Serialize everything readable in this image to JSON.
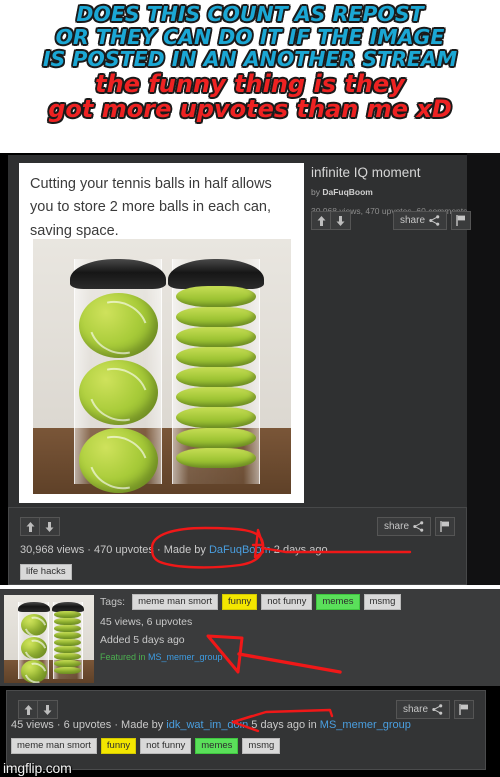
{
  "meme": {
    "caption_top_lines": [
      "DOES THIS COUNT AS REPOST",
      "OR THEY CAN DO IT IF THE IMAGE",
      "IS POSTED IN AN ANOTHER STREAM"
    ],
    "caption_bottom_lines": [
      "the funny thing is they",
      "got more upvotes than me xD"
    ],
    "caption_top_color": "#1ba7d4",
    "caption_bottom_color": "#ee2222",
    "watermark": "imgflip.com"
  },
  "post_top": {
    "image_caption": "Cutting your tennis balls in half allows you to store 2 more balls in each can, saving space.",
    "title": "infinite IQ moment",
    "by_prefix": "by ",
    "by_author": "DaFuqBoom",
    "stats": "30,968 views, 470 upvotes, 60 comments",
    "upvote_icon": "arrow-up-icon",
    "downvote_icon": "arrow-down-icon",
    "share_label": "share",
    "share_icon": "share-icon",
    "flag_icon": "flag-icon"
  },
  "post_top_footer": {
    "stat_prefix": "30,968 views · 470 upvotes · Made by ",
    "author": "DaFuqBoom",
    "stat_suffix": " 2 days ago",
    "share_label": "share",
    "tags": [
      {
        "label": "life hacks",
        "color": "default"
      }
    ]
  },
  "post_list_row": {
    "tags_label": "Tags:",
    "tags": [
      {
        "label": "meme man smort",
        "color": "default"
      },
      {
        "label": "funny",
        "color": "yellow"
      },
      {
        "label": "not funny",
        "color": "default"
      },
      {
        "label": "memes",
        "color": "green"
      },
      {
        "label": "msmg",
        "color": "default"
      }
    ],
    "views_line": "45 views, 6 upvotes",
    "added_line": "Added 5 days ago",
    "featured_prefix": "Featured in ",
    "featured_stream": "MS_memer_group"
  },
  "post_bottom": {
    "stat_prefix": "45 views · 6 upvotes · Made by ",
    "author": "idk_wat_im_doin",
    "stat_middle": " 5 days ago in ",
    "stream": "MS_memer_group",
    "share_label": "share",
    "tags": [
      {
        "label": "meme man smort",
        "color": "default"
      },
      {
        "label": "funny",
        "color": "yellow"
      },
      {
        "label": "not funny",
        "color": "default"
      },
      {
        "label": "memes",
        "color": "green"
      },
      {
        "label": "msmg",
        "color": "default"
      }
    ]
  },
  "annotations": {
    "color": "#f01818",
    "marks": [
      "circle-around-dafuqboom-2-days-ago",
      "arrow-pointing-to-featured-in-line",
      "arrow-pointing-to-made-by-line"
    ]
  }
}
